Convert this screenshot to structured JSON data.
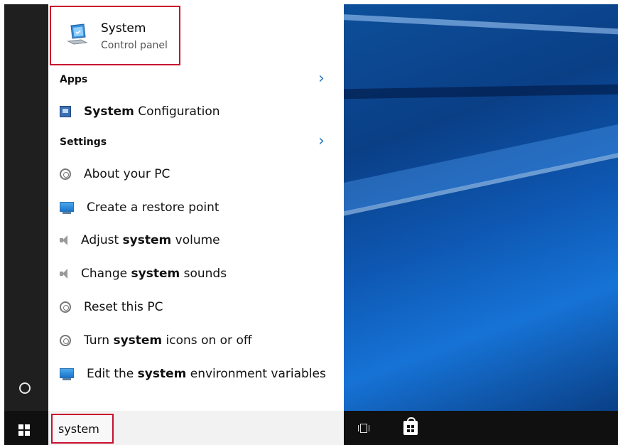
{
  "best_match": {
    "title": "System",
    "subtitle": "Control panel",
    "icon": "system-pc-icon"
  },
  "sections": {
    "apps": {
      "header": "Apps"
    },
    "settings": {
      "header": "Settings"
    }
  },
  "apps_items": [
    {
      "pre": "",
      "bold": "System",
      "post": " Configuration",
      "icon": "msconfig-icon"
    }
  ],
  "settings_items": [
    {
      "pre": "About your PC",
      "bold": "",
      "post": "",
      "icon": "gear-icon"
    },
    {
      "pre": "Create a restore point",
      "bold": "",
      "post": "",
      "icon": "monitor-icon"
    },
    {
      "pre": "Adjust ",
      "bold": "system",
      "post": " volume",
      "icon": "speaker-icon"
    },
    {
      "pre": "Change ",
      "bold": "system",
      "post": " sounds",
      "icon": "speaker-icon"
    },
    {
      "pre": "Reset this PC",
      "bold": "",
      "post": "",
      "icon": "gear-icon"
    },
    {
      "pre": "Turn ",
      "bold": "system",
      "post": " icons on or off",
      "icon": "gear-icon"
    },
    {
      "pre": "Edit the ",
      "bold": "system",
      "post": " environment variables",
      "icon": "monitor-icon"
    }
  ],
  "search": {
    "value": "system"
  },
  "colors": {
    "highlight_border": "#c8102e",
    "chevron": "#2b79c2",
    "taskbar": "#101010"
  }
}
